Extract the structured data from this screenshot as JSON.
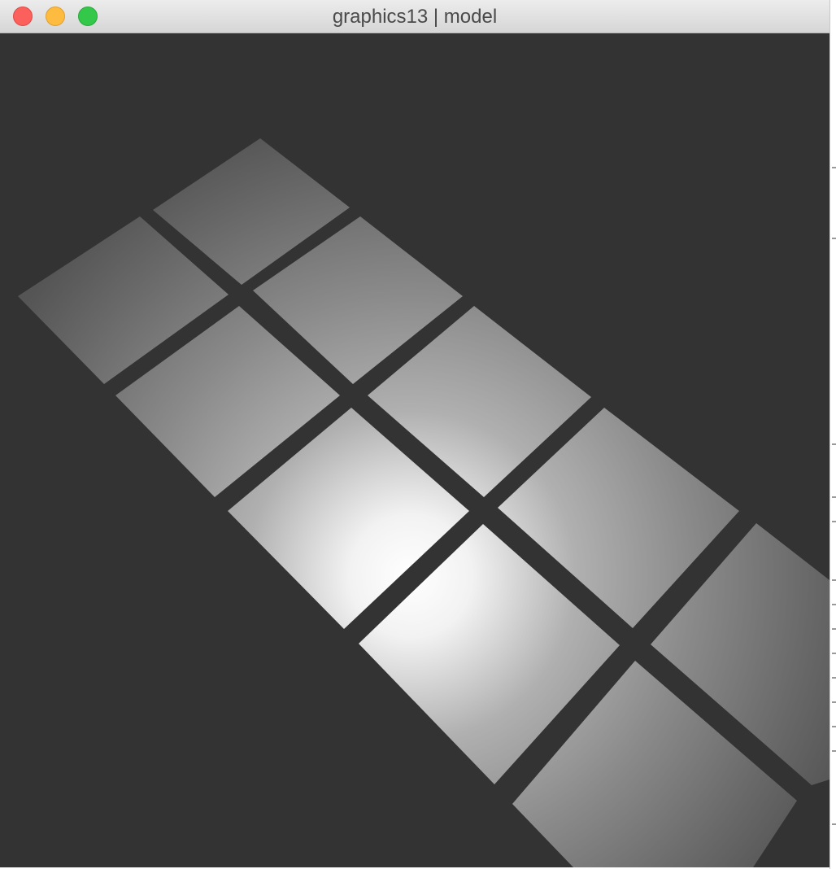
{
  "window": {
    "title": "graphics13 | model"
  },
  "scene": {
    "background_color": "#333333",
    "tile_color_dark": "#5e5e5e",
    "tile_color_highlight": "#ffffff",
    "tile_count": 11
  },
  "icons": {
    "close": "traffic-light-close",
    "minimize": "traffic-light-minimize",
    "zoom": "traffic-light-zoom"
  }
}
